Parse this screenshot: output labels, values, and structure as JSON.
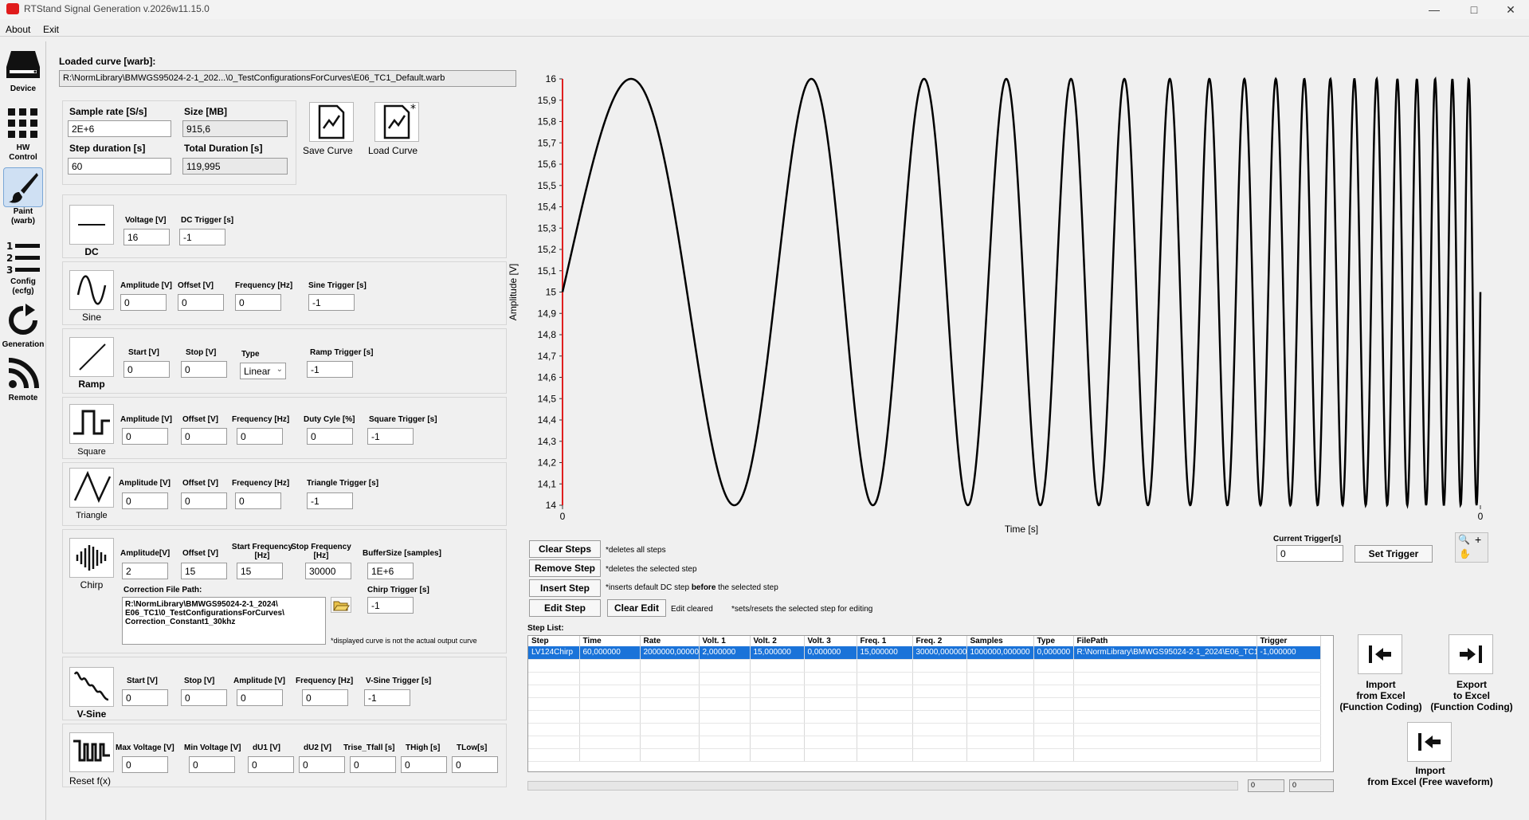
{
  "window": {
    "title": "RTStand Signal Generation v.2026w11.15.0"
  },
  "menu": [
    "About",
    "Exit"
  ],
  "sidebar": [
    {
      "label": "Device",
      "icon": "device-icon"
    },
    {
      "label": "HW Control",
      "icon": "grid-icon"
    },
    {
      "label": "Paint (warb)",
      "icon": "paintbrush-icon"
    },
    {
      "label": "Config (ecfg)",
      "icon": "numbered-list-icon"
    },
    {
      "label": "Generation",
      "icon": "refresh-icon"
    },
    {
      "label": "Remote",
      "icon": "rss-icon"
    }
  ],
  "loaded": {
    "label": "Loaded curve [warb]:",
    "path": "R:\\NormLibrary\\BMWGS95024-2-1_202...\\0_TestConfigurationsForCurves\\E06_TC1_Default.warb"
  },
  "params": {
    "sample_rate_label": "Sample rate [S/s]",
    "sample_rate": "2E+6",
    "size_label": "Size [MB]",
    "size": "915,6",
    "step_duration_label": "Step duration [s]",
    "step_duration": "60",
    "total_duration_label": "Total Duration [s]",
    "total_duration": "119,995"
  },
  "curve_buttons": {
    "save": "Save Curve",
    "load": "Load Curve"
  },
  "dc": {
    "name": "DC",
    "voltage_label": "Voltage [V]",
    "voltage": "16",
    "trigger_label": "DC Trigger [s]",
    "trigger": "-1"
  },
  "sine": {
    "name": "Sine",
    "amp_label": "Amplitude [V]",
    "amp": "0",
    "offset_label": "Offset [V]",
    "offset": "0",
    "freq_label": "Frequency [Hz]",
    "freq": "0",
    "trigger_label": "Sine Trigger [s]",
    "trigger": "-1"
  },
  "ramp": {
    "name": "Ramp",
    "start_label": "Start [V]",
    "start": "0",
    "stop_label": "Stop [V]",
    "stop": "0",
    "type_label": "Type",
    "type": "Linear",
    "trigger_label": "Ramp Trigger [s]",
    "trigger": "-1"
  },
  "square": {
    "name": "Square",
    "amp_label": "Amplitude [V]",
    "amp": "0",
    "offset_label": "Offset [V]",
    "offset": "0",
    "freq_label": "Frequency [Hz]",
    "freq": "0",
    "duty_label": "Duty Cyle [%]",
    "duty": "0",
    "trigger_label": "Square Trigger [s]",
    "trigger": "-1"
  },
  "triangle": {
    "name": "Triangle",
    "amp_label": "Amplitude [V]",
    "amp": "0",
    "offset_label": "Offset [V]",
    "offset": "0",
    "freq_label": "Frequency [Hz]",
    "freq": "0",
    "trigger_label": "Triangle Trigger [s]",
    "trigger": "-1"
  },
  "chirp": {
    "name": "Chirp",
    "amp_label": "Amplitude[V]",
    "amp": "2",
    "offset_label": "Offset [V]",
    "offset": "15",
    "start_label_1": "Start Frequency",
    "start_label_2": "[Hz]",
    "start": "15",
    "stop_label_1": "Stop Frequency",
    "stop_label_2": "[Hz]",
    "stop": "30000",
    "buffer_label": "BufferSize [samples]",
    "buffer": "1E+6",
    "corr_label": "Correction File Path:",
    "corr_path": "R:\\NormLibrary\\BMWGS95024-2-1_2024\\\nE06_TC1\\0_TestConfigurationsForCurves\\\nCorrection_Constant1_30khz",
    "trigger_label": "Chirp Trigger [s]",
    "trigger": "-1",
    "note": "*displayed curve is not the actual output curve"
  },
  "vsine": {
    "name": "V-Sine",
    "start_label": "Start [V]",
    "start": "0",
    "stop_label": "Stop [V]",
    "stop": "0",
    "amp_label": "Amplitude [V]",
    "amp": "0",
    "freq_label": "Frequency [Hz]",
    "freq": "0",
    "trigger_label": "V-Sine Trigger [s]",
    "trigger": "-1"
  },
  "resetf": {
    "name": "Reset f(x)",
    "maxv_label": "Max Voltage [V]",
    "maxv": "0",
    "minv_label": "Min Voltage [V]",
    "minv": "0",
    "du1_label": "dU1 [V]",
    "du1": "0",
    "du2_label": "dU2 [V]",
    "du2": "0",
    "trise_label": "Trise_Tfall [s]",
    "trise": "0",
    "thigh_label": "THigh [s]",
    "thigh": "0",
    "tlow_label": "TLow[s]",
    "tlow": "0"
  },
  "chart_data": {
    "type": "line",
    "title": "",
    "xlabel": "Time [s]",
    "ylabel": "Amplitude [V]",
    "ylim": [
      14,
      16
    ],
    "yticks": [
      "16",
      "15,9",
      "15,8",
      "15,7",
      "15,6",
      "15,5",
      "15,4",
      "15,3",
      "15,2",
      "15,1",
      "15",
      "14,9",
      "14,8",
      "14,7",
      "14,6",
      "14,5",
      "14,4",
      "14,3",
      "14,2",
      "14,1",
      "14"
    ],
    "xticks": [
      "0",
      "0"
    ],
    "series": [
      {
        "offset": 15,
        "amplitude": 1,
        "peaks_shown": 19
      }
    ],
    "trigger_line_color": "#e02020",
    "line_color": "#000000"
  },
  "steps": {
    "clear": "Clear Steps",
    "clear_note": "*deletes all steps",
    "remove": "Remove Step",
    "remove_note": "*deletes the selected step",
    "insert": "Insert Step",
    "insert_note_a": "*inserts default DC step ",
    "insert_note_b": "before",
    "insert_note_c": " the selected step",
    "edit": "Edit Step",
    "clear_edit": "Clear Edit",
    "edit_status": "Edit cleared",
    "edit_note": "*sets/resets the selected step for editing"
  },
  "trigger": {
    "label": "Current Trigger[s]",
    "value": "0",
    "set": "Set Trigger"
  },
  "step_list": {
    "label": "Step List:",
    "columns": [
      "Step",
      "Time",
      "Rate",
      "Volt. 1",
      "Volt. 2",
      "Volt. 3",
      "Freq. 1",
      "Freq. 2",
      "Samples",
      "Type",
      "FilePath",
      "Trigger"
    ],
    "rows": [
      [
        "LV124Chirp",
        "60,000000",
        "2000000,000000",
        "2,000000",
        "15,000000",
        "0,000000",
        "15,000000",
        "30000,000000",
        "1000000,000000",
        "0,000000",
        "R:\\NormLibrary\\BMWGS95024-2-1_2024\\E06_TC1\\",
        "-1,000000"
      ]
    ]
  },
  "status": {
    "field1": "0",
    "field2": "0"
  },
  "excel": {
    "import_fc": "Import\nfrom Excel\n(Function Coding)",
    "export_fc": "Export\nto Excel\n(Function Coding)",
    "import_fw": "Import\nfrom Excel (Free waveform)"
  }
}
